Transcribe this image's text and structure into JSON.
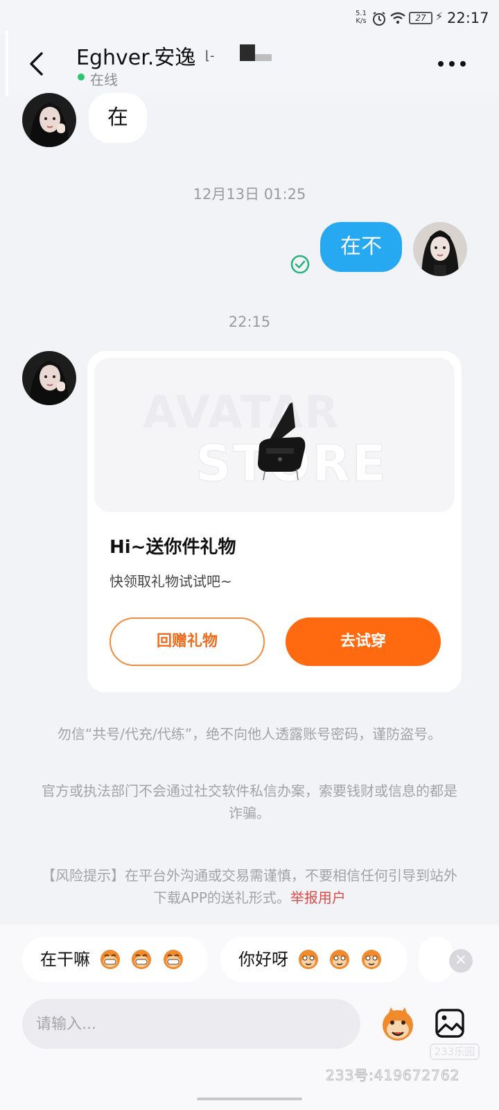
{
  "status_bar": {
    "speed": "5.1 K/s",
    "battery": "27",
    "time": "22:17"
  },
  "header": {
    "title": "Eghver.安逸",
    "status": "在线"
  },
  "messages": [
    {
      "from": "them",
      "text": "在"
    },
    {
      "timestamp": "12月13日 01:25"
    },
    {
      "from": "me",
      "text": "在不",
      "read": true
    },
    {
      "timestamp": "22:15"
    }
  ],
  "gift_card": {
    "watermark_line1": "AVATAR",
    "watermark_line2": "STORE",
    "title": "Hi~送你件礼物",
    "subtitle": "快领取礼物试试吧~",
    "secondary_button": "回赠礼物",
    "primary_button": "去试穿"
  },
  "notices": {
    "line1": "勿信“共号/代充/代练”，绝不向他人透露账号密码，谨防盗号。",
    "line2": "官方或执法部门不会通过社交软件私信办案，索要钱财或信息的都是诈骗。",
    "risk": "【风险提示】在平台外沟通或交易需谨慎，不要相信任何引导到站外下载APP的送礼形式。",
    "report_link": "举报用户"
  },
  "quick_replies": [
    {
      "text": "在干嘛",
      "emoji": "grinning-monkey-emoji"
    },
    {
      "text": "你好呀",
      "emoji": "waving-monkey-emoji"
    }
  ],
  "input": {
    "placeholder": "请输入..."
  },
  "watermark": {
    "logo": "233乐园",
    "id": "233号:419672762"
  },
  "colors": {
    "accent_orange": "#ff6a10",
    "my_bubble": "#27a9f2",
    "online": "#2ec46b",
    "report": "#e04a45"
  }
}
